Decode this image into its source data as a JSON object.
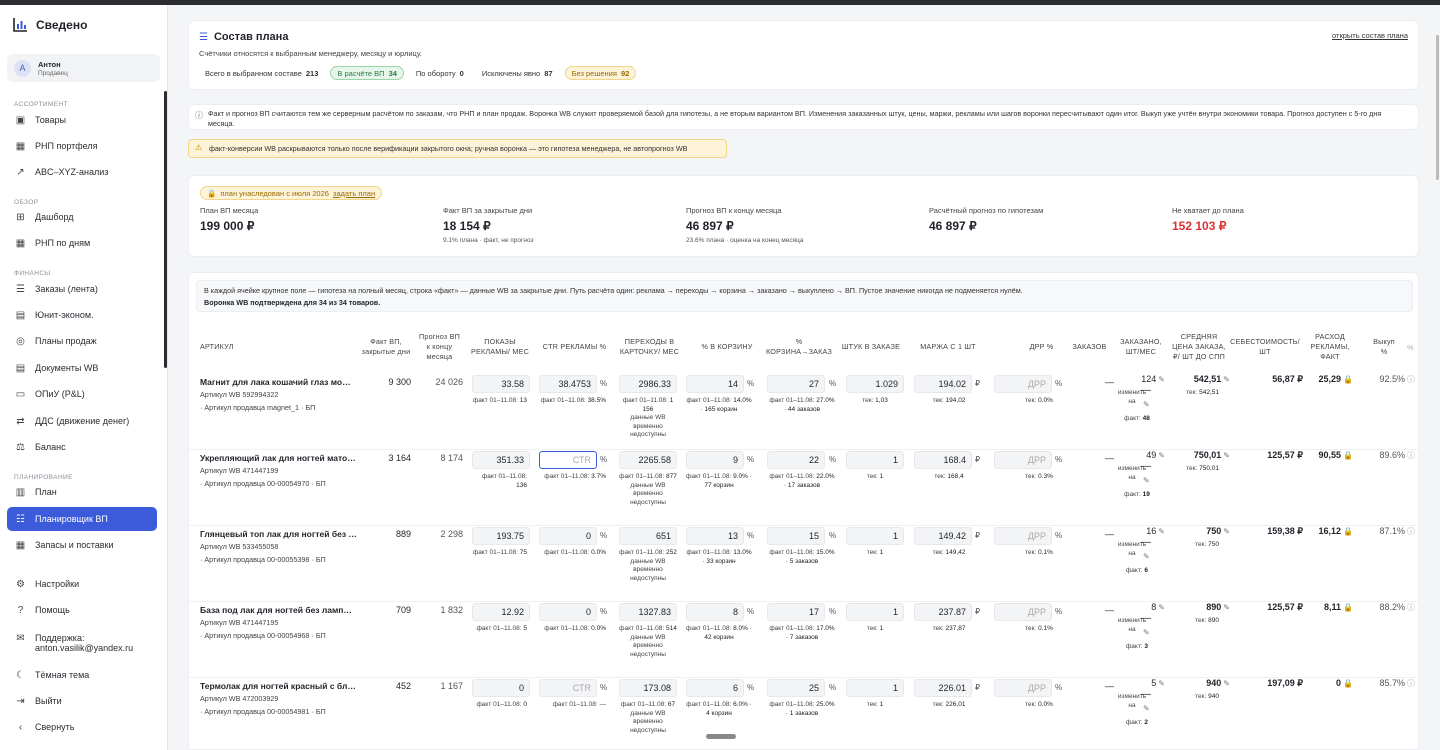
{
  "app": {
    "title": "Сведено"
  },
  "user": {
    "name": "Антон",
    "role": "Продавец",
    "initial": "А"
  },
  "sidebar": {
    "sections": {
      "assortment": "АССОРТИМЕНТ",
      "overview": "ОБЗОР",
      "finance": "ФИНАНСЫ",
      "planning": "ПЛАНИРОВАНИЕ"
    },
    "items": [
      {
        "label": "Товары",
        "icon": "box-icon"
      },
      {
        "label": "РНП портфеля",
        "icon": "calendar-icon"
      },
      {
        "label": "ABC–XYZ-анализ",
        "icon": "trend-icon"
      },
      {
        "label": "Дашборд",
        "icon": "grid-icon"
      },
      {
        "label": "РНП по дням",
        "icon": "calendar-icon"
      },
      {
        "label": "Заказы (лента)",
        "icon": "list-icon"
      },
      {
        "label": "Юнит-эконом.",
        "icon": "doc-icon"
      },
      {
        "label": "Планы продаж",
        "icon": "target-icon"
      },
      {
        "label": "Документы WB",
        "icon": "doc-icon"
      },
      {
        "label": "ОПиУ (P&L)",
        "icon": "wallet-icon"
      },
      {
        "label": "ДДС (движение денег)",
        "icon": "flow-icon"
      },
      {
        "label": "Баланс",
        "icon": "scale-icon"
      },
      {
        "label": "План",
        "icon": "clipboard-icon"
      },
      {
        "label": "Планировщик ВП",
        "icon": "sliders-icon"
      },
      {
        "label": "Запасы и поставки",
        "icon": "stock-icon"
      }
    ],
    "bottom": [
      {
        "label": "Настройки",
        "icon": "gear-icon"
      },
      {
        "label": "Помощь",
        "icon": "help-icon"
      },
      {
        "label": "Поддержка:",
        "label2": "anton.vasilik@yandex.ru",
        "icon": "mail-icon"
      },
      {
        "label": "Тёмная тема",
        "icon": "moon-icon"
      },
      {
        "label": "Выйти",
        "icon": "logout-icon"
      },
      {
        "label": "Свернуть",
        "icon": "chevron-left-icon"
      }
    ]
  },
  "plan_composition": {
    "title": "Состав плана",
    "subtitle": "Счётчики относятся к выбранным менеджеру, месяцу и юрлицу.",
    "open_link": "открыть состав плана",
    "counters": [
      {
        "label": "Всего в выбранном составе",
        "value": "213"
      },
      {
        "label": "В расчёте ВП",
        "value": "34"
      },
      {
        "label": "По обороту",
        "value": "0"
      },
      {
        "label": "Исключены явно",
        "value": "87"
      },
      {
        "label": "Без решения",
        "value": "92"
      }
    ]
  },
  "info": {
    "text": "Факт и прогноз ВП считаются тем же серверным расчётом по заказам, что РНП и план продаж. Воронка WB служит проверяемой базой для гипотезы, а не вторым вариантом ВП. Изменения заказанных штук, цены, маржи, рекламы или шагов воронки пересчитывают один итог. Выкуп уже учтён внутри экономики товара. Прогноз доступен с 5-го дня месяца.",
    "warning": "факт-конверсии WB раскрываются только после верификации закрытого окна; ручная воронка — это гипотеза менеджера, не автопрогноз WB"
  },
  "kpis": {
    "badge": "план унаследован с июля 2026",
    "badge_link": "задать план",
    "items": [
      {
        "title": "План ВП месяца",
        "value": "199 000 ₽",
        "sub": ""
      },
      {
        "title": "Факт ВП за закрытые дни",
        "value": "18 154 ₽",
        "sub": "9.1% плана · факт, не прогноз"
      },
      {
        "title": "Прогноз ВП к концу месяца",
        "value": "46 897 ₽",
        "sub": "23.6% плана · оценка на конец месяца"
      },
      {
        "title": "Расчётный прогноз по гипотезам",
        "value": "46 897 ₽",
        "sub": ""
      },
      {
        "title": "Не хватает до плана",
        "value": "152 103 ₽",
        "sub": ""
      }
    ],
    "shortfall_color": "#e03131"
  },
  "table": {
    "note": "В каждой ячейке крупное поле — гипотеза на полный месяц, строка «факт» — данные WB за закрытые дни. Путь расчёта один: реклама → переходы → корзина → заказано → выкуплено → ВП. Пустое значение никогда не подменяется нулём.",
    "note_bold": "Воронка WB подтверждена для 34 из 34 товаров.",
    "headers": {
      "article": "АРТИКУЛ",
      "fact": "Факт ВП, закрытые дни",
      "forecast": "Прогноз ВП к концу месяца",
      "impr": "ПОКАЗЫ РЕКЛАМЫ/ МЕС",
      "ctr": "CTR РЕКЛАМЫ %",
      "clicks": "ПЕРЕХОДЫ В КАРТОЧКУ/ МЕС",
      "cart": "% В КОРЗИНУ",
      "cart_order": "% КОРЗИНА→ЗАКАЗ",
      "pcs": "ШТУК В ЗАКАЗЕ",
      "margin": "МАРЖА С 1 ШТ",
      "drr": "ДРР %",
      "orders": "ЗАКАЗОВ",
      "ordered": "ЗАКАЗАНО, ШТ/МЕС",
      "avg_price": "СРЕДНЯЯ ЦЕНА ЗАКАЗА, ₽/ ШТ ДО СПП",
      "cost": "СЕБЕСТОИМОСТЬ/ ШТ",
      "ad_cost": "РАСХОД РЕКЛАМЫ, ФАКТ",
      "buyout": "Выкуп %",
      "pct": "%"
    },
    "labels": {
      "fact_window": "факт 01–11.08:",
      "clicks_na": "данные WB временно недоступны",
      "tek": "тек:",
      "change": "изменить на",
      "fact": "факт:",
      "drr_placeholder": "ДРР",
      "ctr_placeholder": "СТR",
      "bp": "БП",
      "art_wb": "Артикул WB",
      "art_seller": "· Артикул продавца",
      "rub": "₽",
      "pct": "%"
    },
    "rows": [
      {
        "name": "Магнит для лака кошачий глаз мо…",
        "wb": "592994322",
        "seller": "magnet_1",
        "fact": "9 300",
        "forecast": "24 026",
        "impr": "33.58",
        "impr_f": "13",
        "ctr": "38.4753",
        "ctr_f": "38.5%",
        "clicks": "2986.33",
        "clicks_f": "1 156",
        "cart": "14",
        "cart_f": "14.0% · 165 корзин",
        "co": "27",
        "co_f": "27.0% · 44 заказов",
        "pcs": "1.029",
        "pcs_t": "1,03",
        "margin": "194.02",
        "margin_t": "194,02",
        "drr_t": "0.0%",
        "orders": "—",
        "ordered": "124",
        "ordered_f": "48",
        "price": "542,51",
        "price_t": "542,51",
        "cost": "56,87 ₽",
        "ad": "25,29",
        "buyout": "92.5%"
      },
      {
        "name": "Укрепляющий лак для ногтей мато…",
        "wb": "471447199",
        "seller": "00-00054970",
        "fact": "3 164",
        "forecast": "8 174",
        "impr": "351.33",
        "impr_f": "136",
        "ctr": "",
        "ctr_f": "3.7%",
        "clicks": "2265.58",
        "clicks_f": "877",
        "cart": "9",
        "cart_f": "9.0% · 77 корзин",
        "co": "22",
        "co_f": "22.0% · 17 заказов",
        "pcs": "1",
        "pcs_t": "1",
        "margin": "168.4",
        "margin_t": "168,4",
        "drr_t": "0.3%",
        "orders": "—",
        "ordered": "49",
        "ordered_f": "19",
        "price": "750,01",
        "price_t": "750,01",
        "cost": "125,57 ₽",
        "ad": "90,55",
        "buyout": "89.6%"
      },
      {
        "name": "Глянцевый топ лак для ногтей без …",
        "wb": "533455058",
        "seller": "00-00055398",
        "fact": "889",
        "forecast": "2 298",
        "impr": "193.75",
        "impr_f": "75",
        "ctr": "0",
        "ctr_f": "0.0%",
        "clicks": "651",
        "clicks_f": "252",
        "cart": "13",
        "cart_f": "13.0% · 33 корзин",
        "co": "15",
        "co_f": "15.0% · 5 заказов",
        "pcs": "1",
        "pcs_t": "1",
        "margin": "149.42",
        "margin_t": "149,42",
        "drr_t": "0.1%",
        "orders": "—",
        "ordered": "16",
        "ordered_f": "6",
        "price": "750",
        "price_t": "750",
        "cost": "159,38 ₽",
        "ad": "16,12",
        "buyout": "87.1%"
      },
      {
        "name": "База под лак для ногтей без ламп…",
        "wb": "471447195",
        "seller": "00-00054968",
        "fact": "709",
        "forecast": "1 832",
        "impr": "12.92",
        "impr_f": "5",
        "ctr": "0",
        "ctr_f": "0.0%",
        "clicks": "1327.83",
        "clicks_f": "514",
        "cart": "8",
        "cart_f": "8.0% · 42 корзин",
        "co": "17",
        "co_f": "17.0% · 7 заказов",
        "pcs": "1",
        "pcs_t": "1",
        "margin": "237.87",
        "margin_t": "237,87",
        "drr_t": "0.1%",
        "orders": "—",
        "ordered": "8",
        "ordered_f": "3",
        "price": "890",
        "price_t": "890",
        "cost": "125,57 ₽",
        "ad": "8,11",
        "buyout": "88.2%"
      },
      {
        "name": "Термолак для ногтей красный с бл…",
        "wb": "472003929",
        "seller": "00-00054981",
        "fact": "452",
        "forecast": "1 167",
        "impr": "0",
        "impr_f": "0",
        "ctr": "",
        "ctr_f": "",
        "clicks": "173.08",
        "clicks_f": "67",
        "cart": "6",
        "cart_f": "6.0% · 4 корзин",
        "co": "25",
        "co_f": "25.0% · 1 заказов",
        "pcs": "1",
        "pcs_t": "1",
        "margin": "226.01",
        "margin_t": "226,01",
        "drr_t": "0.0%",
        "orders": "—",
        "ordered": "5",
        "ordered_f": "2",
        "price": "940",
        "price_t": "940",
        "cost": "197,09 ₽",
        "ad": "0",
        "buyout": "85.7%"
      }
    ]
  }
}
